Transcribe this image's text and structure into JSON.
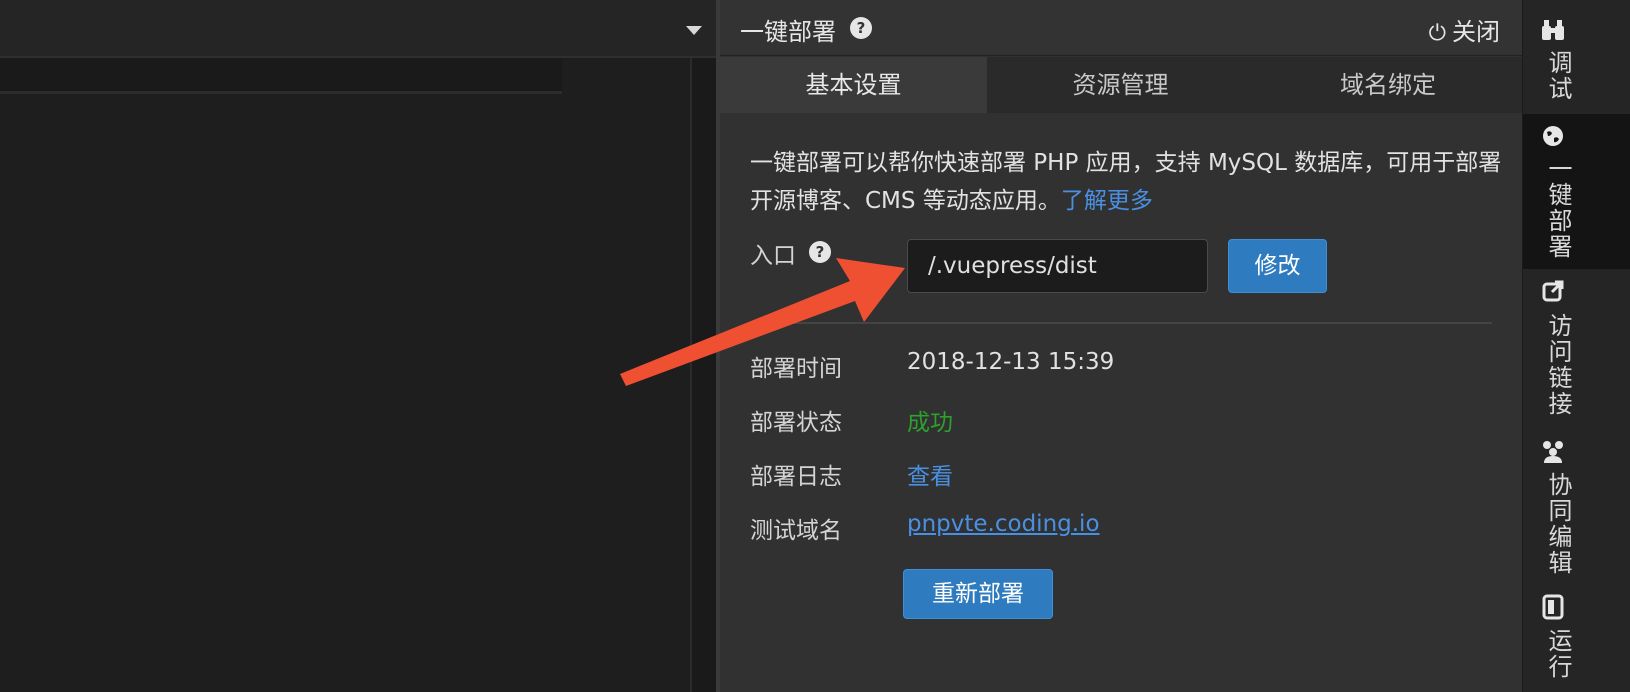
{
  "panel": {
    "title": "一键部署",
    "close_label": "关闭",
    "tabs": [
      {
        "label": "基本设置",
        "active": true
      },
      {
        "label": "资源管理",
        "active": false
      },
      {
        "label": "域名绑定",
        "active": false
      }
    ],
    "description": "一键部署可以帮你快速部署 PHP 应用，支持 MySQL 数据库，可用于部署开源博客、CMS 等动态应用。",
    "learn_more": "了解更多",
    "entry": {
      "label": "入口",
      "value": "/.vuepress/dist",
      "button": "修改"
    },
    "rows": [
      {
        "label": "部署时间",
        "value": "2018-12-13 15:39"
      },
      {
        "label": "部署状态",
        "value": "成功"
      },
      {
        "label": "部署日志",
        "value": "查看"
      },
      {
        "label": "测试域名",
        "value": "pnpvte.coding.io"
      }
    ],
    "redeploy_button": "重新部署"
  },
  "sidebar": {
    "items": [
      {
        "label": "调试",
        "icon": "binoculars-icon"
      },
      {
        "label": "一键部署",
        "icon": "globe-icon",
        "active": true
      },
      {
        "label": "访问链接",
        "icon": "external-link-icon"
      },
      {
        "label": "协同编辑",
        "icon": "users-icon"
      },
      {
        "label": "运行",
        "icon": "terminal-icon"
      }
    ]
  },
  "colors": {
    "accent_button": "#2f7bbf",
    "link": "#4a90e2",
    "success": "#2da02d",
    "annotation_arrow": "#f05032"
  }
}
